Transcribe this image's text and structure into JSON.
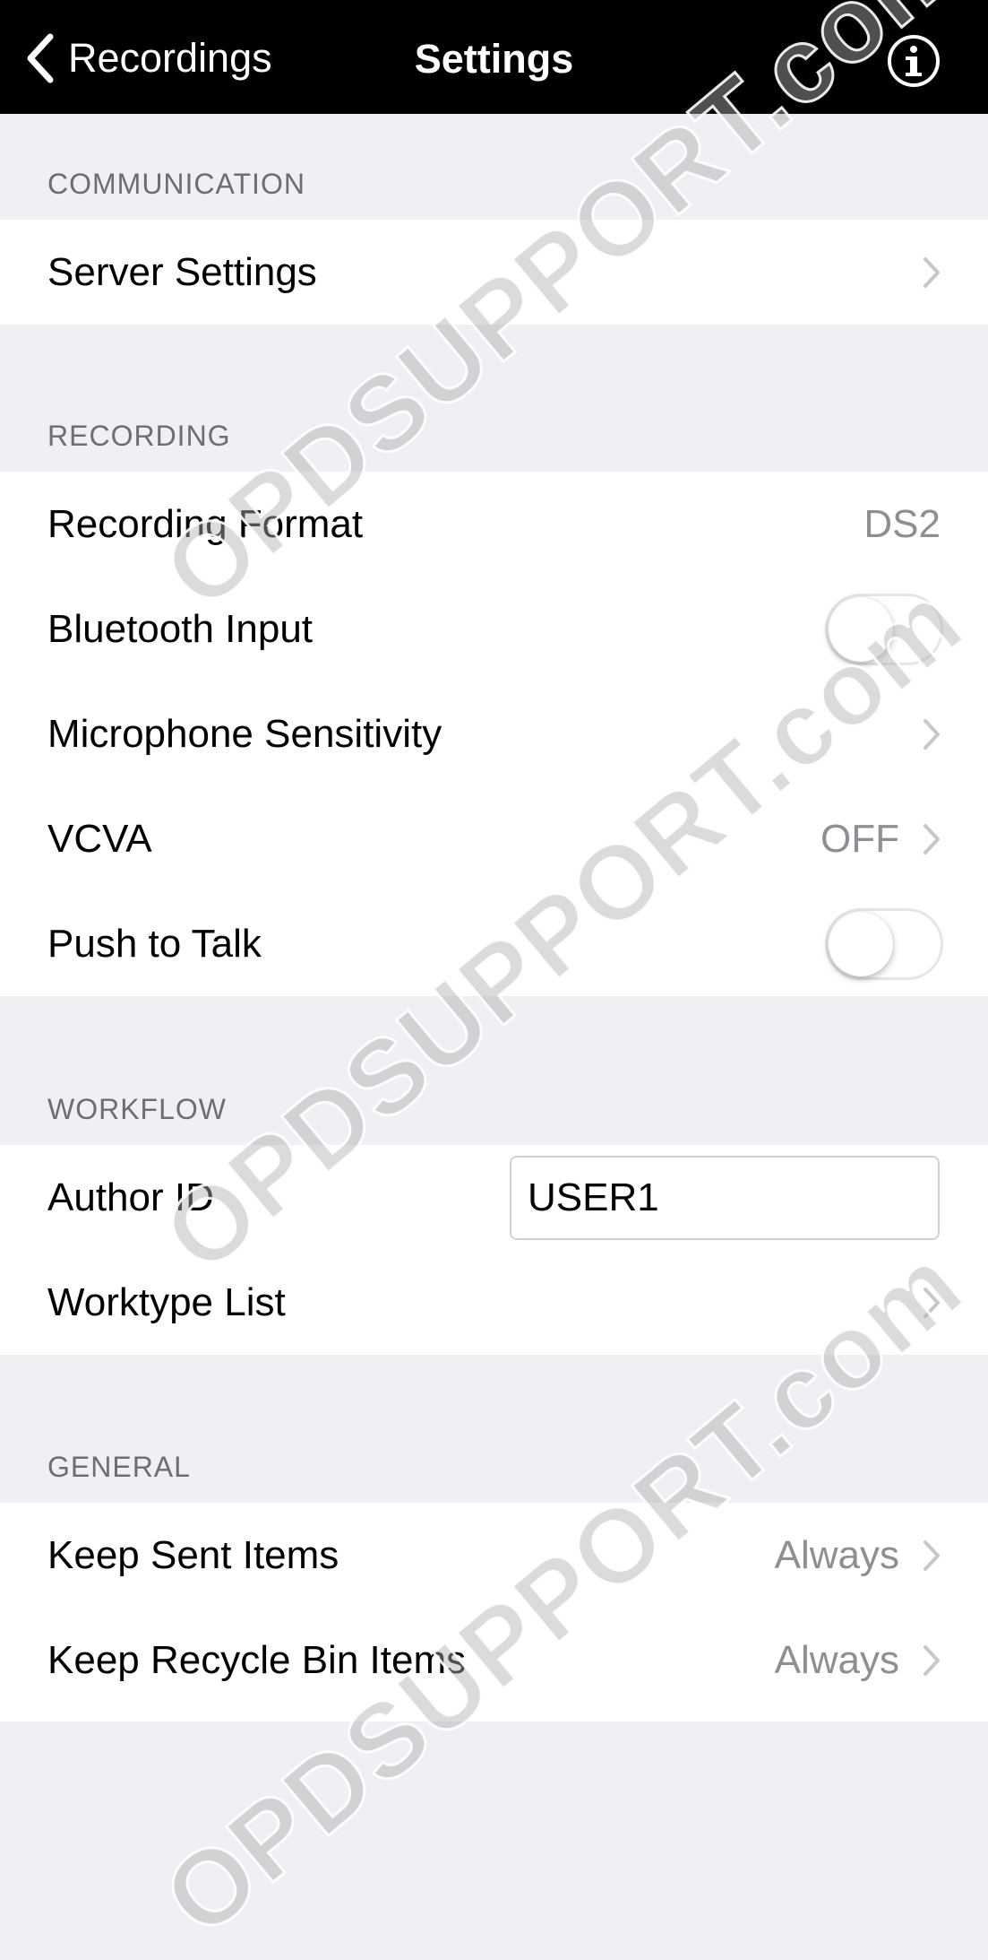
{
  "navbar": {
    "back_label": "Recordings",
    "title": "Settings"
  },
  "sections": {
    "communication": {
      "header": "COMMUNICATION",
      "server_settings": "Server Settings"
    },
    "recording": {
      "header": "RECORDING",
      "recording_format": {
        "label": "Recording Format",
        "value": "DS2"
      },
      "bluetooth_input": {
        "label": "Bluetooth Input",
        "enabled": false
      },
      "microphone_sensitivity": {
        "label": "Microphone Sensitivity"
      },
      "vcva": {
        "label": "VCVA",
        "value": "OFF"
      },
      "push_to_talk": {
        "label": "Push to Talk",
        "enabled": false
      }
    },
    "workflow": {
      "header": "WORKFLOW",
      "author_id": {
        "label": "Author ID",
        "value": "USER1"
      },
      "worktype_list": {
        "label": "Worktype List"
      }
    },
    "general": {
      "header": "GENERAL",
      "keep_sent_items": {
        "label": "Keep Sent Items",
        "value": "Always"
      },
      "keep_recycle_bin_items": {
        "label": "Keep Recycle Bin Items",
        "value": "Always"
      }
    }
  },
  "watermark": {
    "text_1": "OPDSUPPORT.com",
    "text_2": "OPDSUPPORT.com",
    "text_3": "OPDSUPPORT.com"
  },
  "colors": {
    "navbar_bg": "#000000",
    "page_bg": "#efeff4",
    "section_header": "#6d6d72",
    "secondary_value": "#8e8e93",
    "chevron": "#c7c7cc"
  },
  "icons": {
    "back": "chevron-left-icon",
    "info": "info-circle-icon",
    "disclosure": "chevron-right-icon"
  }
}
